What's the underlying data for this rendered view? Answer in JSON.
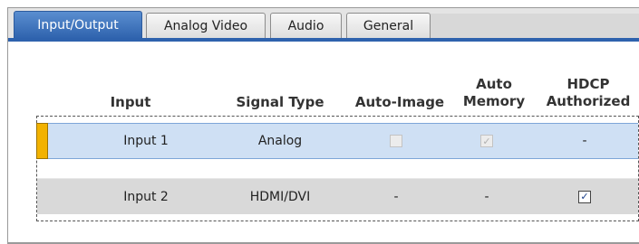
{
  "tabs": [
    {
      "label": "Input/Output",
      "active": true
    },
    {
      "label": "Analog Video",
      "active": false
    },
    {
      "label": "Audio",
      "active": false
    },
    {
      "label": "General",
      "active": false
    }
  ],
  "table": {
    "headers": {
      "input": "Input",
      "signal_type": "Signal Type",
      "auto_image": "Auto-Image",
      "auto_memory_line1": "Auto",
      "auto_memory_line2": "Memory",
      "hdcp_line1": "HDCP",
      "hdcp_line2": "Authorized"
    },
    "rows": [
      {
        "input": "Input 1",
        "signal_type": "Analog",
        "auto_image": {
          "type": "checkbox",
          "checked": false,
          "enabled": false
        },
        "auto_memory": {
          "type": "checkbox",
          "checked": true,
          "enabled": false
        },
        "hdcp_authorized": "-",
        "selected": true
      },
      {
        "input": "Input 2",
        "signal_type": "HDMI/DVI",
        "auto_image": "-",
        "auto_memory": "-",
        "hdcp_authorized": {
          "type": "checkbox",
          "checked": true,
          "enabled": true
        },
        "selected": false
      }
    ]
  },
  "colors": {
    "tab_active": "#2e62ad",
    "row_selected": "#cfe0f4",
    "row_handle": "#f2b200",
    "row_alt": "#d9d9d9"
  },
  "icons": {
    "check": "✓"
  }
}
